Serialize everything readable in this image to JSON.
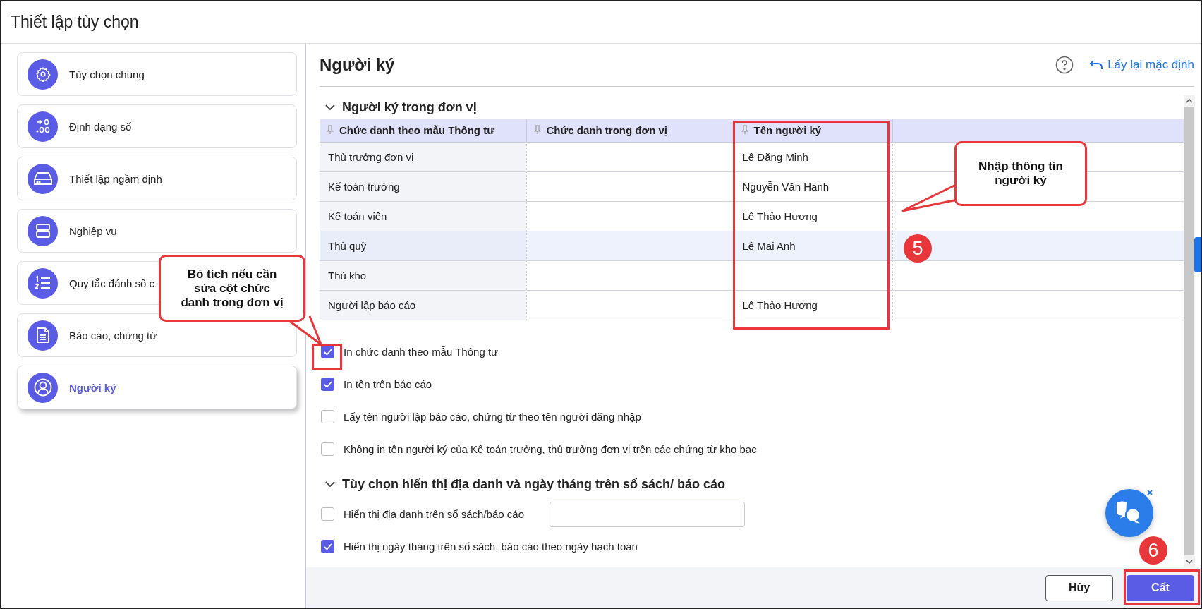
{
  "window": {
    "title": "Thiết lập tùy chọn"
  },
  "sidebar": {
    "items": [
      {
        "label": "Tùy chọn chung",
        "selected": false
      },
      {
        "label": "Định dạng số",
        "selected": false
      },
      {
        "label": "Thiết lập ngầm định",
        "selected": false
      },
      {
        "label": "Nghiệp vụ",
        "selected": false
      },
      {
        "label": "Quy tắc đánh số c",
        "selected": false
      },
      {
        "label": "Báo cáo, chứng từ",
        "selected": false
      },
      {
        "label": "Người ký",
        "selected": true
      }
    ]
  },
  "panel": {
    "title": "Người ký",
    "reset_link": "Lấy lại mặc định"
  },
  "sections": [
    {
      "title": "Người ký trong đơn vị",
      "expanded": true,
      "table": {
        "columns": [
          "Chức danh theo mẫu Thông tư",
          "Chức danh trong đơn vị",
          "Tên người ký"
        ],
        "rows": [
          {
            "cells": [
              "Thủ trưởng đơn vị",
              "",
              "Lê Đăng Minh"
            ],
            "selected": false
          },
          {
            "cells": [
              "Kế toán trưởng",
              "",
              "Nguyễn Văn Hanh"
            ],
            "selected": false
          },
          {
            "cells": [
              "Kế toán viên",
              "",
              "Lê Thảo Hương"
            ],
            "selected": false
          },
          {
            "cells": [
              "Thủ quỹ",
              "",
              "Lê Mai Anh"
            ],
            "selected": true
          },
          {
            "cells": [
              "Thủ kho",
              "",
              ""
            ],
            "selected": false
          },
          {
            "cells": [
              "Người lập báo cáo",
              "",
              "Lê Thảo Hương"
            ],
            "selected": false
          }
        ]
      },
      "options": [
        {
          "kind": "checkbox",
          "label": "In chức danh theo mẫu Thông tư",
          "checked": true
        },
        {
          "kind": "checkbox",
          "label": "In tên trên báo cáo",
          "checked": true
        },
        {
          "kind": "checkbox",
          "label": "Lấy tên người lập báo cáo, chứng từ theo tên người đăng nhập",
          "checked": false
        },
        {
          "kind": "checkbox",
          "label": "Không in tên người ký của Kế toán trưởng, thủ trưởng đơn vị trên các chứng từ kho bạc",
          "checked": false
        }
      ]
    },
    {
      "title": "Tùy chọn hiển thị địa danh và ngày tháng trên sổ sách/ báo cáo",
      "expanded": true,
      "options": [
        {
          "kind": "checkbox_field",
          "label": "Hiển thị địa danh trên sổ sách/báo cáo",
          "checked": false
        },
        {
          "kind": "checkbox",
          "label": "Hiển thị ngày tháng trên sổ sách, báo cáo theo ngày hạch toán",
          "checked": true
        }
      ]
    }
  ],
  "buttons": [
    {
      "label": "Hủy",
      "kind": "secondary"
    },
    {
      "label": "Cất",
      "kind": "primary"
    }
  ],
  "annotations": {
    "callouts": [
      "Nhập thông tin người ký",
      "Bỏ tích nếu cần sửa cột chức danh trong đơn vị"
    ],
    "steps": [
      "5",
      "6"
    ]
  }
}
